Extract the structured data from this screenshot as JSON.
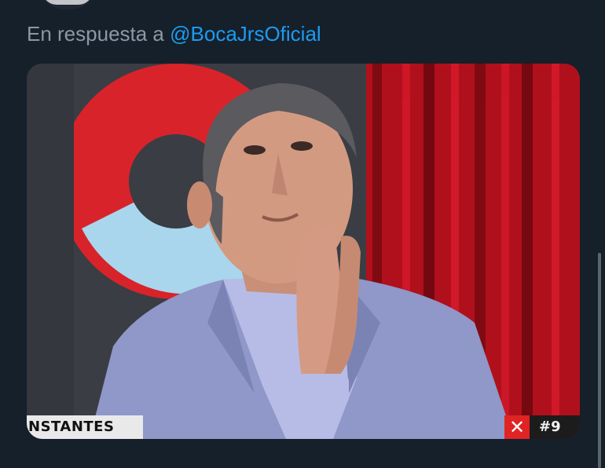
{
  "reply": {
    "prefix": "En respuesta a",
    "mention": "@BocaJrsOficial"
  },
  "media": {
    "overlay_left": "NSTANTES",
    "overlay_close": "✕",
    "overlay_hashtag": "#9"
  },
  "colors": {
    "background": "#15202b",
    "mention": "#1d9bf0",
    "muted_text": "#8b98a5",
    "badge_red": "#e02424"
  }
}
